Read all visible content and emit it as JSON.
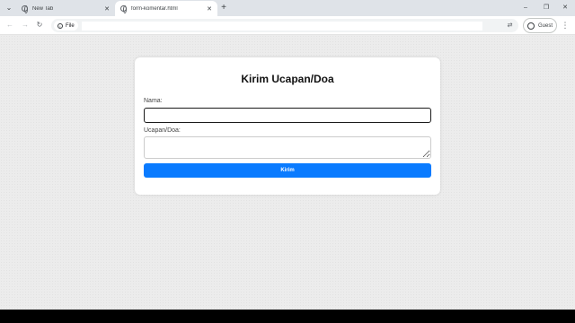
{
  "browser": {
    "tabs": [
      {
        "title": "New Tab",
        "active": false
      },
      {
        "title": "form-komentar.html",
        "active": true
      }
    ],
    "new_tab_icon": "+",
    "window_controls": {
      "minimize": "–",
      "restore": "❐",
      "close": "✕"
    },
    "address": {
      "chip_label": "File",
      "url": ""
    },
    "profile_label": "Guest"
  },
  "form": {
    "title": "Kirim Ucapan/Doa",
    "name_label": "Nama:",
    "name_value": "",
    "message_label": "Ucapan/Doa:",
    "message_value": "",
    "submit_label": "Kirim"
  },
  "colors": {
    "accent": "#0a7bff",
    "page_background": "#ececec",
    "tabstrip": "#dfe3e8"
  }
}
